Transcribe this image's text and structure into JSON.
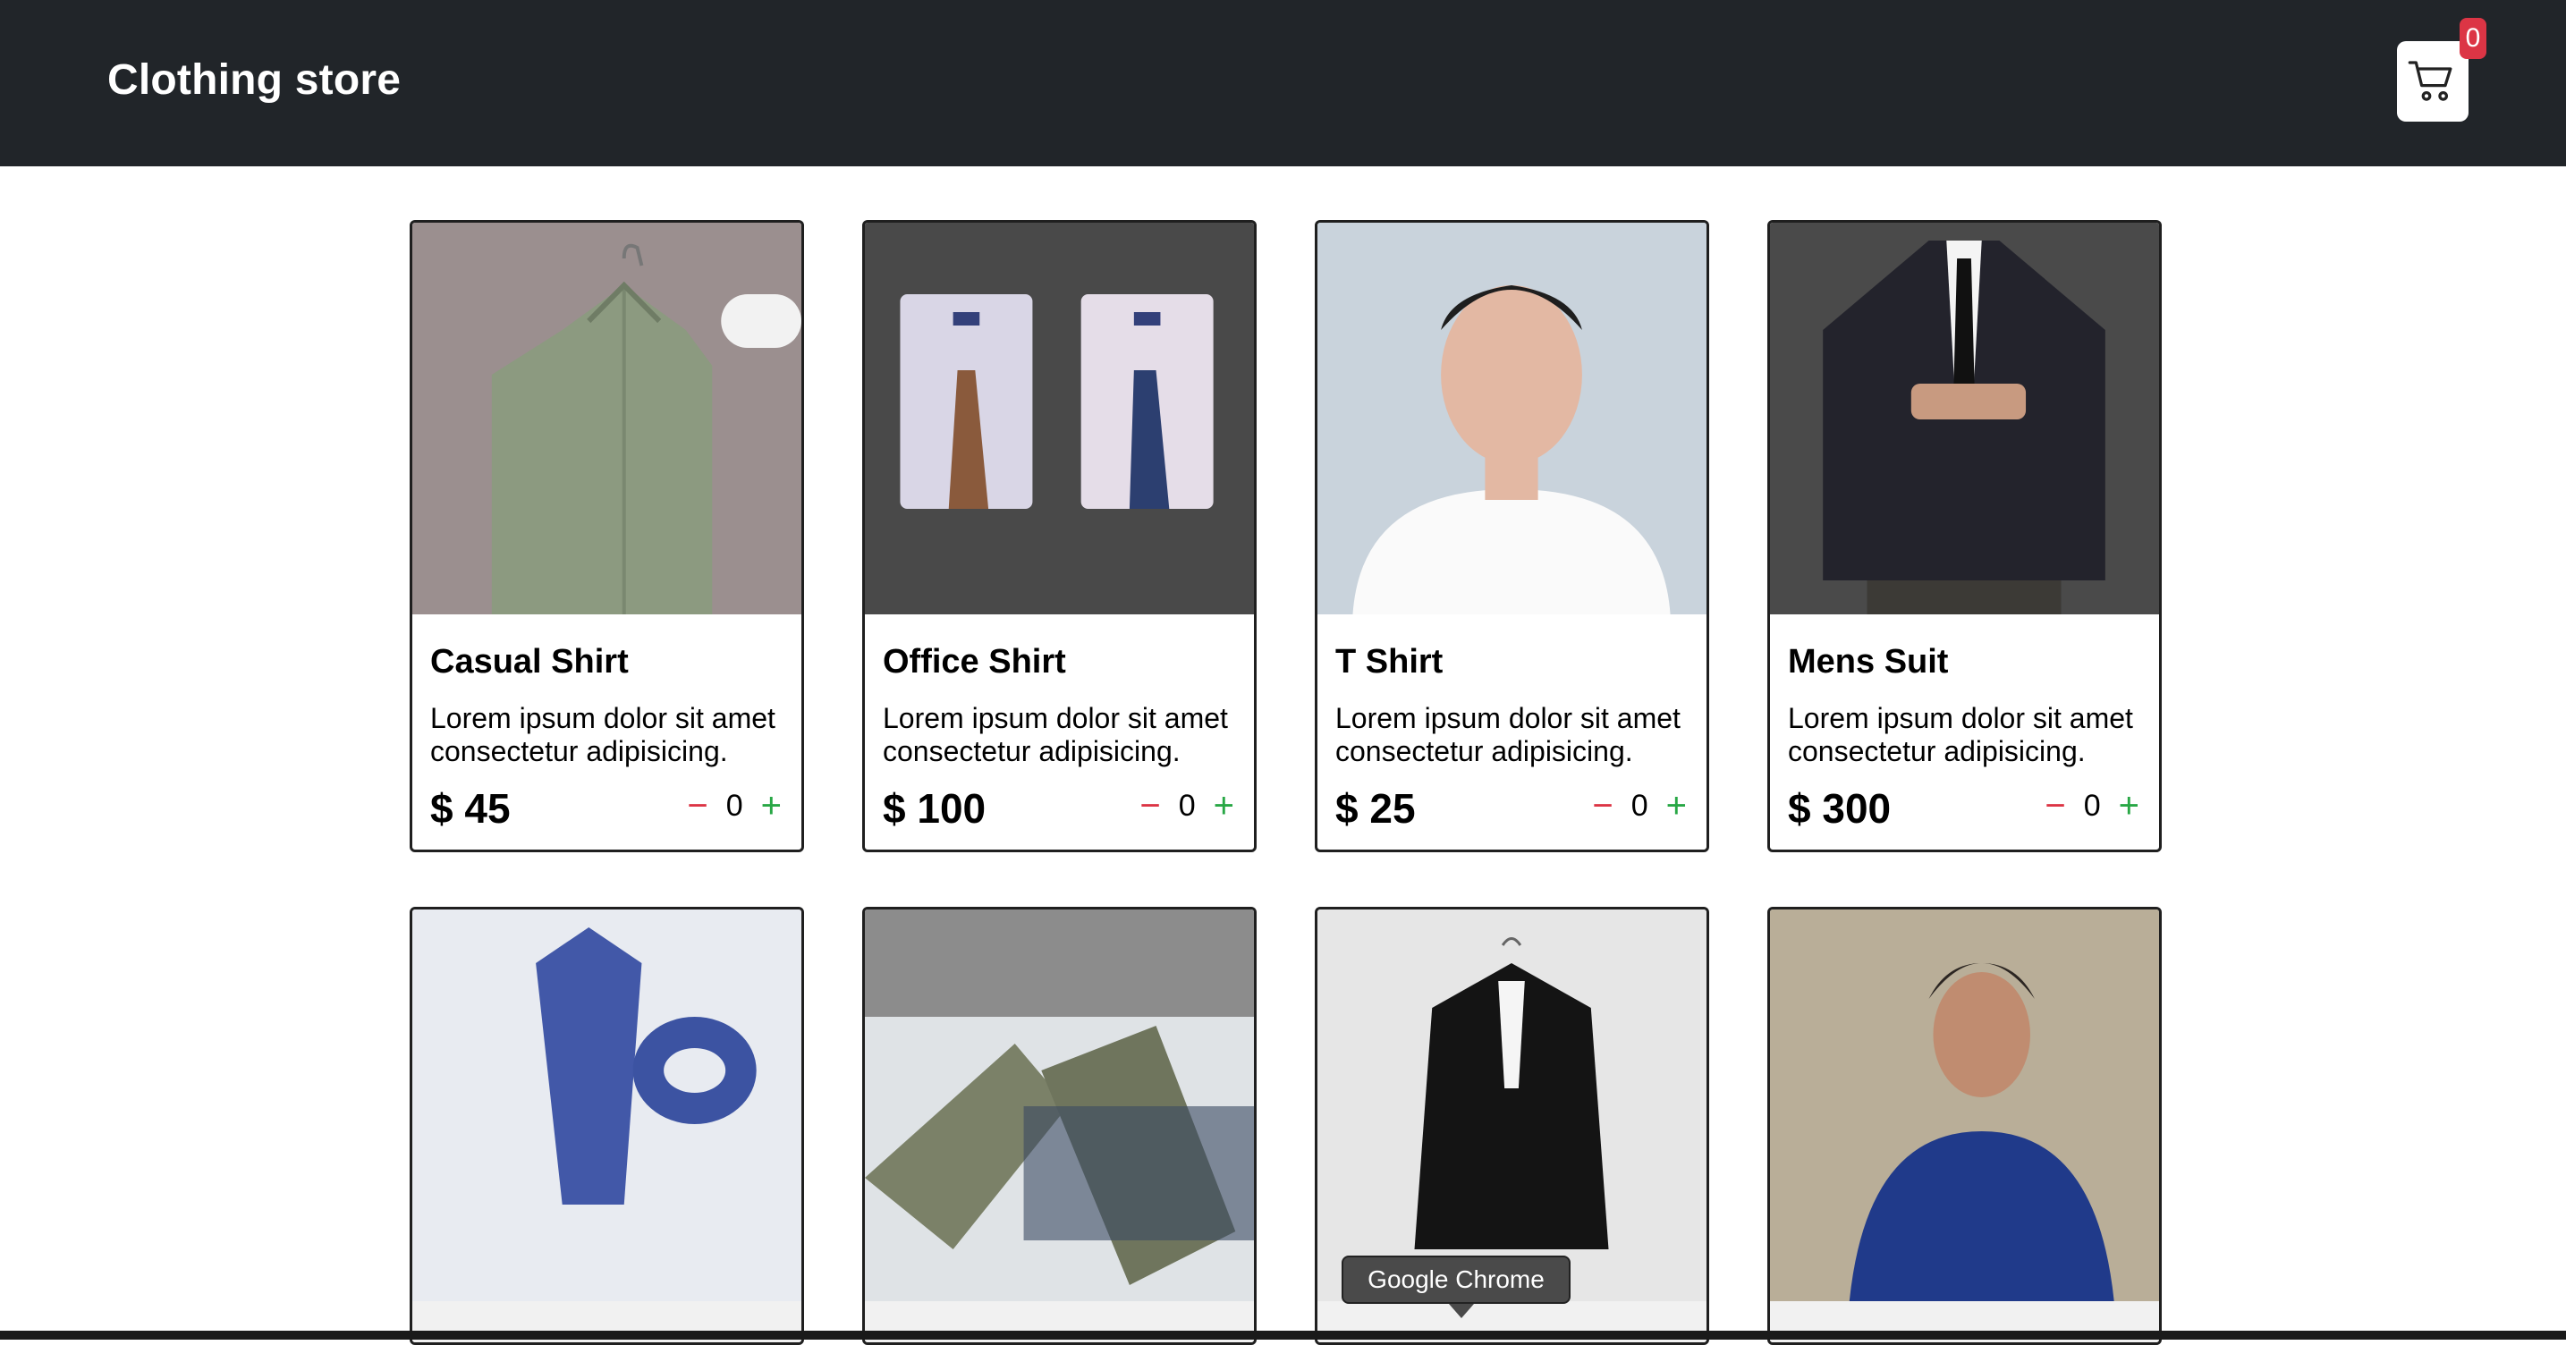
{
  "header": {
    "title": "Clothing store",
    "cart_count": "0",
    "cart_icon": "shopping-cart-icon",
    "background": "#212529"
  },
  "products": [
    {
      "name": "Casual Shirt",
      "description": "Lorem ipsum dolor sit amet consectetur adipisicing.",
      "price": "$ 45",
      "quantity": "0",
      "minus": "−",
      "plus": "+",
      "image": "green shirt on hanger"
    },
    {
      "name": "Office Shirt",
      "description": "Lorem ipsum dolor sit amet consectetur adipisicing.",
      "price": "$ 100",
      "quantity": "0",
      "minus": "−",
      "plus": "+",
      "image": "two folded dress shirts with ties"
    },
    {
      "name": "T Shirt",
      "description": "Lorem ipsum dolor sit amet consectetur adipisicing.",
      "price": "$ 25",
      "quantity": "0",
      "minus": "−",
      "plus": "+",
      "image": "man in white t-shirt"
    },
    {
      "name": "Mens Suit",
      "description": "Lorem ipsum dolor sit amet consectetur adipisicing.",
      "price": "$ 300",
      "quantity": "0",
      "minus": "−",
      "plus": "+",
      "image": "man in dark suit"
    }
  ],
  "products_row2": [
    {
      "image": "blue patterned tie"
    },
    {
      "image": "green sneakers and jeans"
    },
    {
      "image": "black blazer on hanger"
    },
    {
      "image": "man in navy polo shirt"
    }
  ],
  "tooltip": {
    "label": "Google Chrome"
  },
  "colors": {
    "minus": "#dc3545",
    "plus": "#28a745",
    "badge": "#dc3545"
  }
}
